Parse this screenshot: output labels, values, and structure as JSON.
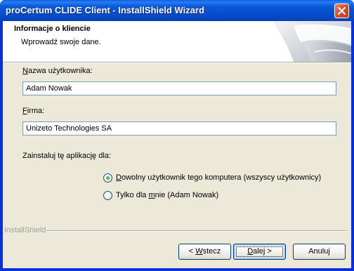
{
  "window": {
    "title": "proCertum CLIDE Client - InstallShield Wizard"
  },
  "header": {
    "title": "Informacje o kliencie",
    "subtitle": "Wprowadź swoje dane."
  },
  "form": {
    "username_label_mnemonic": "N",
    "username_label_rest": "azwa użytkownika:",
    "username_value": "Adam Nowak",
    "company_label_mnemonic": "F",
    "company_label_rest": "irma:",
    "company_value": "Unizeto Technologies SA",
    "install_for_label": "Zainstaluj tę aplikację dla:",
    "radio_all_mnemonic": "D",
    "radio_all_rest": "owolny użytkownik tego komputera (wszyscy użytkownicy)",
    "radio_all_selected": true,
    "radio_me_prefix": "Tylko dla ",
    "radio_me_mnemonic": "m",
    "radio_me_rest": "nie (Adam Nowak)",
    "radio_me_selected": false
  },
  "footer": {
    "brand": "InstallShield",
    "back_prefix": "< ",
    "back_mnemonic": "W",
    "back_rest": "stecz",
    "next_mnemonic": "D",
    "next_rest": "alej >",
    "cancel_label": "Anuluj"
  },
  "colors": {
    "titlebar": "#0a5ad8",
    "window_border": "#0831d9",
    "dialog_bg": "#ece9d8",
    "field_border": "#7f9db9"
  },
  "icons": {
    "close": "close-icon",
    "radio_selected": "radio-selected-icon",
    "radio_empty": "radio-empty-icon",
    "header_art": "header-graphic-icon"
  }
}
